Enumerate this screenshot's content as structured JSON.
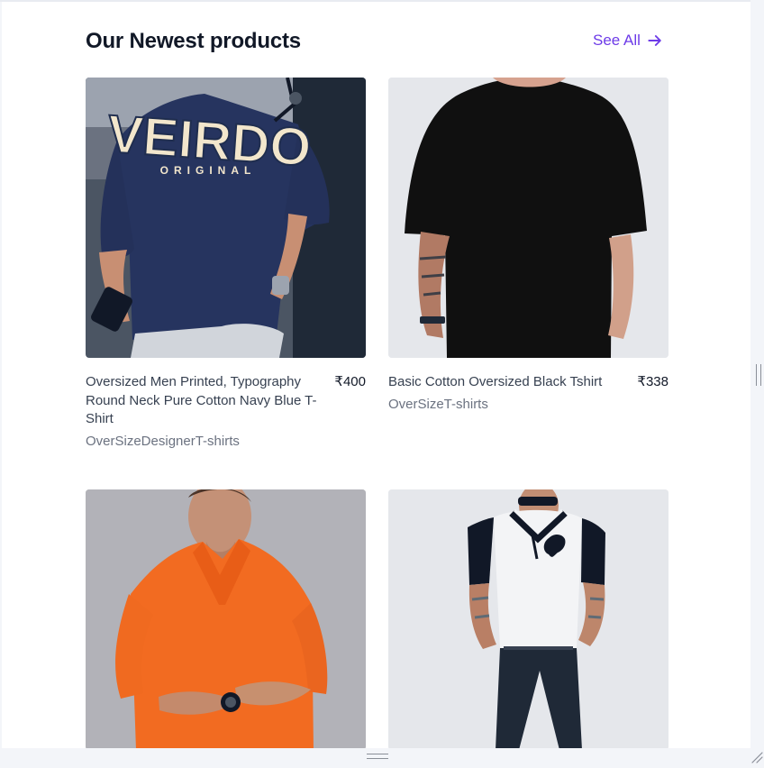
{
  "section": {
    "title": "Our Newest products",
    "see_all_label": "See All",
    "see_all_icon": "arrow-right-icon",
    "accent_color": "#6d3be8"
  },
  "products": [
    {
      "name": "Oversized Men Printed, Typography Round Neck Pure Cotton Navy Blue T-Shirt",
      "price": "₹400",
      "category": "OverSizeDesignerT-shirts",
      "image_label": "VEIRDO",
      "image_sublabel": "ORIGINAL"
    },
    {
      "name": "Basic Cotton Oversized Black Tshirt",
      "price": "₹338",
      "category": "OverSizeT-shirts"
    },
    {
      "image_subject": "orange-polo-model"
    },
    {
      "image_subject": "white-black-polo-model"
    }
  ],
  "window": {
    "vertical_splitter_icon": "vertical-splitter-handle-icon",
    "horizontal_splitter_icon": "horizontal-splitter-handle-icon",
    "resize_grip_icon": "resize-grip-icon"
  }
}
